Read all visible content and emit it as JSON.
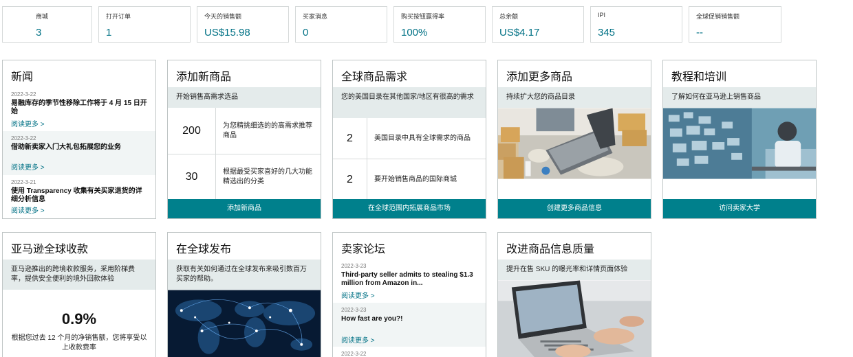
{
  "metrics": [
    {
      "label": "商城",
      "value": "3"
    },
    {
      "label": "打开订单",
      "value": "1"
    },
    {
      "label": "今天的销售额",
      "value": "US$15.98"
    },
    {
      "label": "买家消息",
      "value": "0"
    },
    {
      "label": "购买按钮赢得率",
      "value": "100%"
    },
    {
      "label": "总余额",
      "value": "US$4.17"
    },
    {
      "label": "IPI",
      "value": "345"
    },
    {
      "label": "全球促销销售额",
      "value": "--"
    }
  ],
  "news": {
    "title": "新闻",
    "items": [
      {
        "date": "2022-3-22",
        "text": "易融库存的季节性移除工作将于 4 月 15 日开始",
        "link": "阅读更多 >"
      },
      {
        "date": "2022-3-22",
        "text": "借助新卖家入门大礼包拓展您的业务",
        "link": "阅读更多 >"
      },
      {
        "date": "2022-3-21",
        "text": "使用 Transparency 收集有关买家退货的详细分析信息",
        "link": "阅读更多 >"
      }
    ]
  },
  "add_product": {
    "title": "添加新商品",
    "desc": "开始销售高需求选品",
    "rows": [
      {
        "value": "200",
        "text": "为您精挑细选的的高需求推荐商品"
      },
      {
        "value": "30",
        "text": "根据最受买家喜好的几大功能精选出的分类"
      }
    ],
    "button": "添加新商品"
  },
  "global_demand": {
    "title": "全球商品需求",
    "desc": "您的美国目录在其他国家/地区有很高的需求",
    "rows": [
      {
        "value": "2",
        "text": "美国目录中具有全球需求的商品"
      },
      {
        "value": "2",
        "text": "要开始销售商品的国际商城"
      }
    ],
    "button": "在全球范围内拓展商品市场"
  },
  "add_more": {
    "title": "添加更多商品",
    "desc": "持续扩大您的商品目录",
    "button": "创建更多商品信息"
  },
  "tutorial": {
    "title": "教程和培训",
    "desc": "了解如何在亚马逊上销售商品",
    "button": "访问卖家大学"
  },
  "payment": {
    "title": "亚马逊全球收款",
    "desc": "亚马逊推出的跨境收款服务，采用阶梯费率，提供安全便利的境外回款体验",
    "fee": "0.9%",
    "fee_text": "根据您过去 12 个月的净销售额，您将享受以上收款费率"
  },
  "global_publish": {
    "title": "在全球发布",
    "desc": "获取有关如何通过在全球发布来吸引数百万买家的帮助。"
  },
  "forum": {
    "title": "卖家论坛",
    "items": [
      {
        "date": "2022-3-23",
        "text": "Third-party seller admits to stealing $1.3 million from Amazon in...",
        "link": "阅读更多 >"
      },
      {
        "date": "2022-3-23",
        "text": "How fast are you?!",
        "link": "阅读更多 >"
      },
      {
        "date": "2022-3-22",
        "text": "",
        "link": ""
      }
    ]
  },
  "quality": {
    "title": "改进商品信息质量",
    "desc": "提升在售 SKU 的曝光率和详情页面体验"
  },
  "colors": {
    "accent": "#00808c",
    "link": "#007185",
    "desc_bg": "#e4ebeb",
    "border": "#bfc5c5"
  }
}
